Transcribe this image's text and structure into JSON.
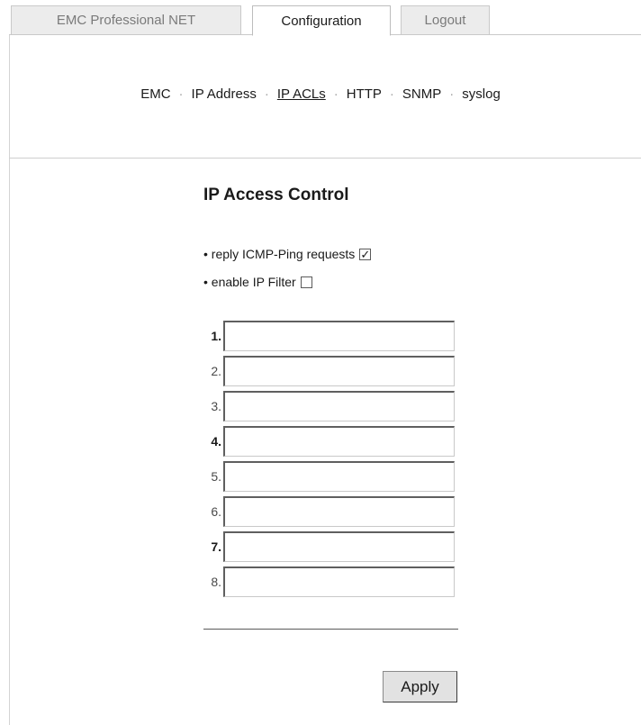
{
  "tabs": [
    {
      "label": "EMC Professional NET",
      "active": false
    },
    {
      "label": "Configuration",
      "active": true
    },
    {
      "label": "Logout",
      "active": false
    }
  ],
  "subnav": {
    "items": [
      "EMC",
      "IP Address",
      "IP ACLs",
      "HTTP",
      "SNMP",
      "syslog"
    ],
    "separator": "·",
    "current": "IP ACLs"
  },
  "page": {
    "title": "IP Access Control",
    "options": [
      {
        "label": "• reply ICMP-Ping requests",
        "checked": true
      },
      {
        "label": "• enable IP Filter",
        "checked": false
      }
    ],
    "acl_entries": [
      {
        "label": "1.",
        "value": ""
      },
      {
        "label": "2.",
        "value": ""
      },
      {
        "label": "3.",
        "value": ""
      },
      {
        "label": "4.",
        "value": ""
      },
      {
        "label": "5.",
        "value": ""
      },
      {
        "label": "6.",
        "value": ""
      },
      {
        "label": "7.",
        "value": ""
      },
      {
        "label": "8.",
        "value": ""
      }
    ],
    "apply_label": "Apply"
  },
  "colors": {
    "tab_inactive_bg": "#ececec",
    "tab_inactive_text": "#7a7a7a",
    "button_bg": "#e2e2e2"
  }
}
